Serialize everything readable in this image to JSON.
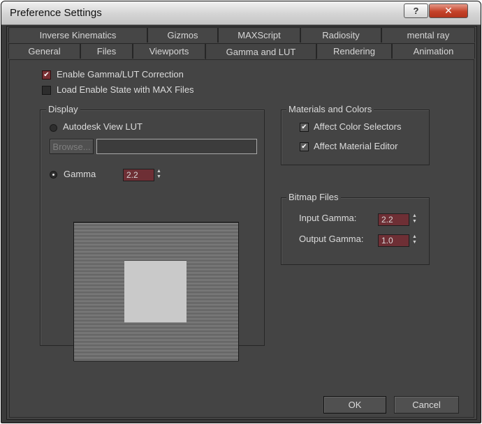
{
  "window": {
    "title": "Preference Settings",
    "help_label": "?",
    "close_label": "✕"
  },
  "tabs": {
    "row1": [
      "Inverse Kinematics",
      "Gizmos",
      "MAXScript",
      "Radiosity",
      "mental ray"
    ],
    "row2": [
      "General",
      "Files",
      "Viewports",
      "Gamma and LUT",
      "Rendering",
      "Animation"
    ],
    "active": "Gamma and LUT"
  },
  "options": {
    "enable_gamma": {
      "label": "Enable Gamma/LUT Correction",
      "checked": true
    },
    "load_enable_state": {
      "label": "Load Enable State with MAX Files",
      "checked": false
    }
  },
  "display": {
    "title": "Display",
    "autodesk_lut_label": "Autodesk View LUT",
    "browse_label": "Browse...",
    "lut_path": "",
    "gamma_label": "Gamma",
    "gamma_value": "2.2"
  },
  "materials": {
    "title": "Materials and Colors",
    "affect_color_selectors": {
      "label": "Affect Color Selectors",
      "checked": true
    },
    "affect_material_editor": {
      "label": "Affect Material Editor",
      "checked": true
    }
  },
  "bitmap": {
    "title": "Bitmap Files",
    "input_label": "Input Gamma:",
    "input_value": "2.2",
    "output_label": "Output Gamma:",
    "output_value": "1.0"
  },
  "buttons": {
    "ok": "OK",
    "cancel": "Cancel"
  },
  "colors": {
    "accent_check": "#7a3034",
    "spinner_field": "#6e2f35",
    "panel_bg": "#444444"
  }
}
